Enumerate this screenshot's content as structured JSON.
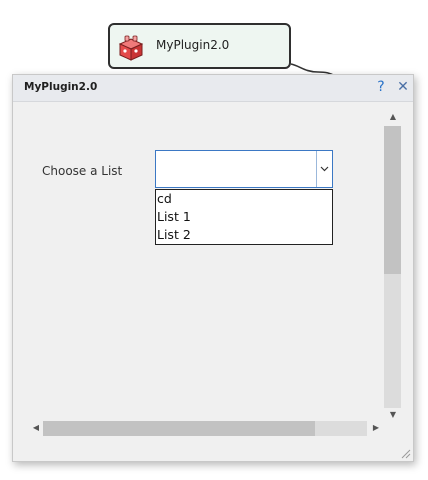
{
  "node": {
    "label": "MyPlugin2.0",
    "icon": "plugin-cube-icon"
  },
  "dialog": {
    "title": "MyPlugin2.0",
    "help_glyph": "?",
    "close_glyph": "✕",
    "field_label": "Choose a List",
    "combo_value": "",
    "options": [
      "cd",
      "List 1",
      "List 2"
    ],
    "accent": "#3b78c4"
  },
  "scroll": {
    "up": "▲",
    "down": "▼",
    "left": "◀",
    "right": "▶"
  }
}
